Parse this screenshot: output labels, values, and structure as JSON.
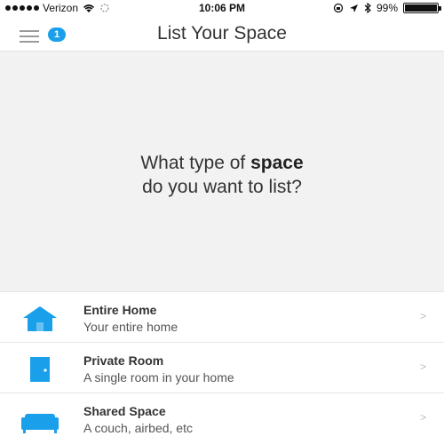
{
  "status_bar": {
    "carrier": "Verizon",
    "time": "10:06 PM",
    "battery": "99%"
  },
  "nav": {
    "title": "List Your Space",
    "badge_count": "1"
  },
  "prompt": {
    "before": "What type of ",
    "emphasis": "space",
    "after": "do you want to list?"
  },
  "options": [
    {
      "icon": "house-icon",
      "title": "Entire Home",
      "subtitle": "Your entire home",
      "chevron": ">"
    },
    {
      "icon": "door-icon",
      "title": "Private Room",
      "subtitle": "A single room in your home",
      "chevron": ">"
    },
    {
      "icon": "couch-icon",
      "title": "Shared Space",
      "subtitle": "A couch, airbed, etc",
      "chevron": ">"
    }
  ],
  "colors": {
    "accent": "#1aa0ea",
    "prompt_bg": "#f2f2f2"
  }
}
